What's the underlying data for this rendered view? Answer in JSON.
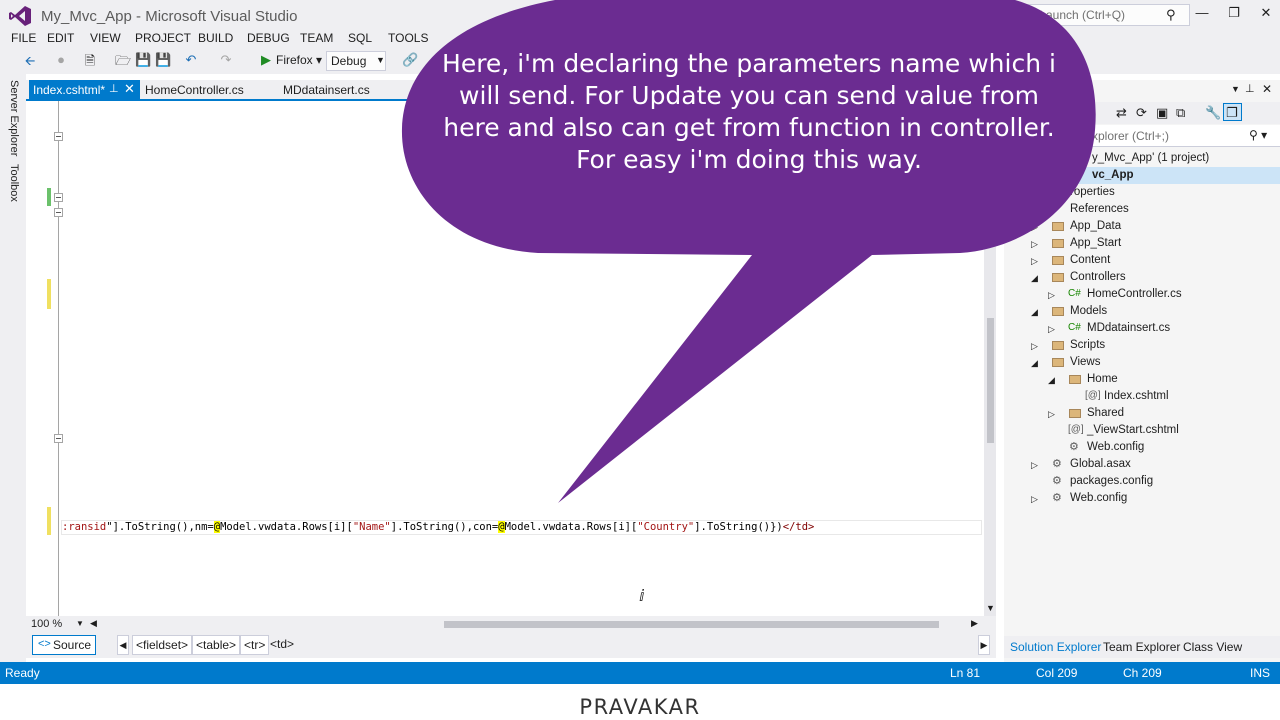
{
  "window": {
    "title": "My_Mvc_App - Microsoft Visual Studio",
    "quick_launch_placeholder": "k Launch (Ctrl+Q)"
  },
  "menu": [
    "FILE",
    "EDIT",
    "VIEW",
    "PROJECT",
    "BUILD",
    "DEBUG",
    "TEAM",
    "SQL",
    "TOOLS"
  ],
  "toolbar": {
    "browser_label": "Firefox",
    "config_label": "Debug"
  },
  "left_strip": {
    "server_explorer": "Server Explorer",
    "toolbox": "Toolbox"
  },
  "doc_tabs": [
    {
      "label": "Index.cshtml*",
      "active": true
    },
    {
      "label": "HomeController.cs",
      "active": false
    },
    {
      "label": "MDdatainsert.cs",
      "active": false
    }
  ],
  "editor": {
    "code_segments": [
      {
        "text": ":ransid",
        "style": "str"
      },
      {
        "text": "\"].ToString(),nm=",
        "style": "plain"
      },
      {
        "text": "@",
        "style": "razor"
      },
      {
        "text": "Model.vwdata.Rows[i][",
        "style": "plain"
      },
      {
        "text": "\"Name\"",
        "style": "str"
      },
      {
        "text": "].ToString(),con=",
        "style": "plain"
      },
      {
        "text": "@",
        "style": "razor"
      },
      {
        "text": "Model.vwdata.Rows[i][",
        "style": "plain"
      },
      {
        "text": "\"Country\"",
        "style": "str"
      },
      {
        "text": "].ToString()",
        "style": "plain"
      },
      {
        "text": "})",
        "style": "plain"
      },
      {
        "text": "</td>",
        "style": "tag"
      }
    ],
    "zoom": "100 %"
  },
  "navbar": {
    "source_label": "Source",
    "breadcrumbs": [
      "<fieldset>",
      "<table>",
      "<tr>"
    ],
    "current": "<td>"
  },
  "solution_explorer": {
    "search_placeholder": "xplorer (Ctrl+;)",
    "solution_label": "y_Mvc_App' (1 project)",
    "project_label": "vc_App",
    "items": [
      {
        "label": "roperties"
      },
      {
        "label": "References"
      },
      {
        "label": "App_Data"
      },
      {
        "label": "App_Start"
      },
      {
        "label": "Content"
      },
      {
        "label": "Controllers"
      },
      {
        "label": "HomeController.cs"
      },
      {
        "label": "Models"
      },
      {
        "label": "MDdatainsert.cs"
      },
      {
        "label": "Scripts"
      },
      {
        "label": "Views"
      },
      {
        "label": "Home"
      },
      {
        "label": "Index.cshtml"
      },
      {
        "label": "Shared"
      },
      {
        "label": "_ViewStart.cshtml"
      },
      {
        "label": "Web.config"
      },
      {
        "label": "Global.asax"
      },
      {
        "label": "packages.config"
      },
      {
        "label": "Web.config"
      }
    ],
    "bottom_tabs": [
      "Solution Explorer",
      "Team Explorer",
      "Class View"
    ]
  },
  "status": {
    "state": "Ready",
    "line": "Ln 81",
    "col": "Col 209",
    "ch": "Ch 209",
    "mode": "INS"
  },
  "callout": {
    "text": "Here, i'm declaring the parameters name which i will send. For Update you can send value from here and also can get from function in controller. For easy i'm doing this way."
  },
  "caption": "PRAVAKAR",
  "colors": {
    "accent": "#007acc",
    "callout": "#6b2c91",
    "chrome": "#efeff2"
  }
}
